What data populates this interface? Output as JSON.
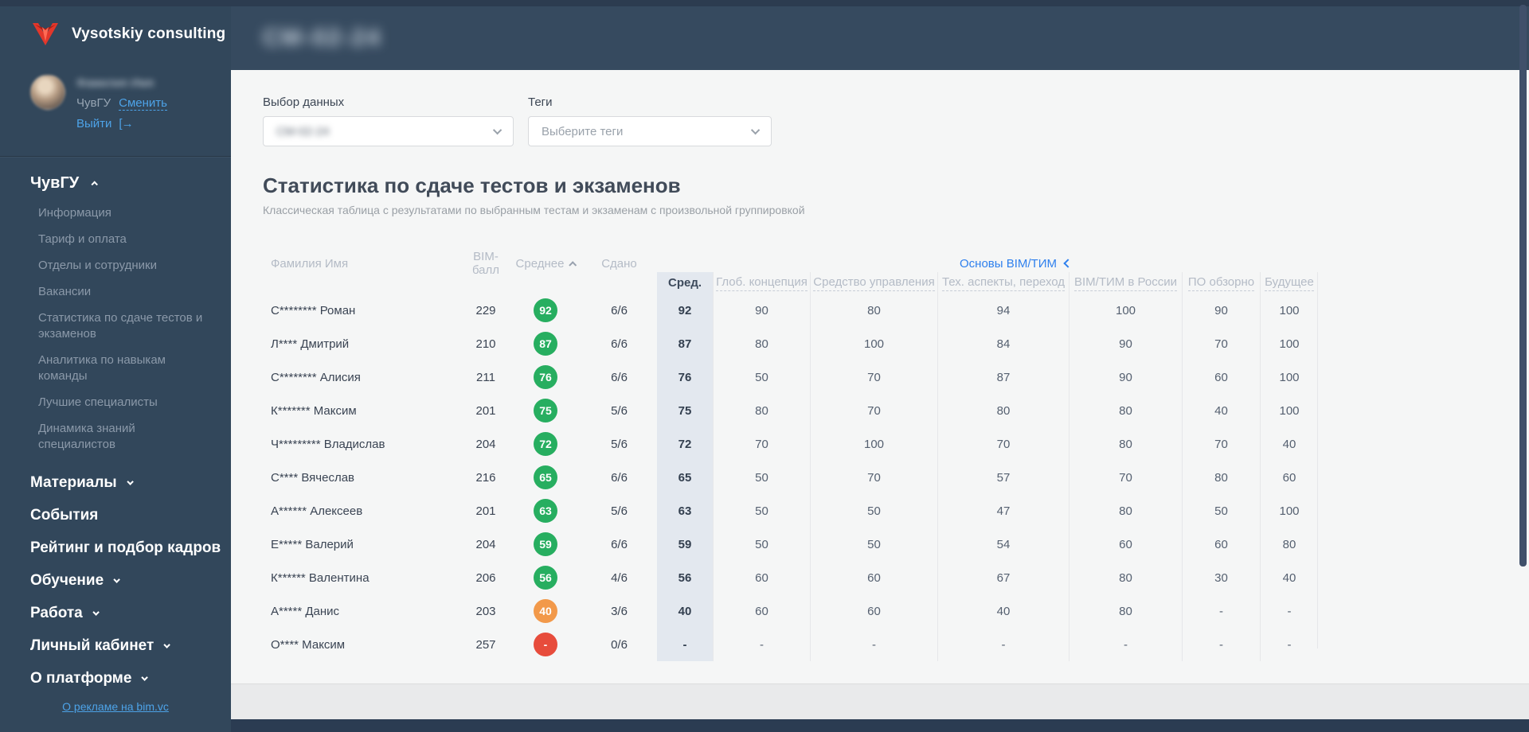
{
  "brand": {
    "name": "Vysotskiy consulting"
  },
  "topbar": {
    "title_redacted": "СМ-02-24"
  },
  "user": {
    "name_redacted": "Фамилия Имя",
    "org": "ЧувГУ",
    "change_link": "Сменить",
    "logout_link": "Выйти"
  },
  "sidebar": {
    "section_label": "ЧувГУ",
    "subitems": [
      {
        "label": "Информация"
      },
      {
        "label": "Тариф и оплата"
      },
      {
        "label": "Отделы и сотрудники"
      },
      {
        "label": "Вакансии"
      },
      {
        "label": "Статистика по сдаче тестов и экзаменов"
      },
      {
        "label": "Аналитика по навыкам команды"
      },
      {
        "label": "Лучшие специалисты"
      },
      {
        "label": "Динамика знаний специалистов"
      }
    ],
    "items": [
      {
        "label": "Материалы",
        "chevron": true
      },
      {
        "label": "События",
        "chevron": false
      },
      {
        "label": "Рейтинг и подбор кадров",
        "chevron": false
      },
      {
        "label": "Обучение",
        "chevron": true
      },
      {
        "label": "Работа",
        "chevron": true
      },
      {
        "label": "Личный кабинет",
        "chevron": true
      },
      {
        "label": "О платформе",
        "chevron": true
      }
    ],
    "footer_link": "О рекламе на bim.vc"
  },
  "filters": {
    "data_select_label": "Выбор данных",
    "data_select_value_redacted": "СМ-02-24",
    "tags_select_label": "Теги",
    "tags_select_placeholder": "Выберите теги"
  },
  "main": {
    "title": "Статистика по сдаче тестов и экзаменов",
    "subtitle": "Классическая таблица с результатами по выбранным тестам и экзаменам с произвольной группировкой",
    "group_link": "Основы BIM/ТИМ"
  },
  "table": {
    "col_name": "Фамилия Имя",
    "col_bim": "BIM-балл",
    "col_avg_badge": "Среднее",
    "col_passed": "Сдано",
    "col_avg": "Сред.",
    "subject_headers": [
      {
        "label": "Глоб. концепция"
      },
      {
        "label": "Средство управления"
      },
      {
        "label": "Тех. аспекты, переход"
      },
      {
        "label": "BIM/ТИМ в России"
      },
      {
        "label": "ПО обзорно"
      },
      {
        "label": "Будущее"
      }
    ],
    "rows": [
      {
        "name": "С******** Роман",
        "bim": "229",
        "badge": "92",
        "badge_color": "#27ae60",
        "passed": "6/6",
        "avg": "92",
        "s1": "90",
        "s2": "80",
        "s3": "94",
        "s4": "100",
        "s5": "90",
        "s6": "100"
      },
      {
        "name": "Л**** Дмитрий",
        "bim": "210",
        "badge": "87",
        "badge_color": "#27ae60",
        "passed": "6/6",
        "avg": "87",
        "s1": "80",
        "s2": "100",
        "s3": "84",
        "s4": "90",
        "s5": "70",
        "s6": "100"
      },
      {
        "name": "С******** Алисия",
        "bim": "211",
        "badge": "76",
        "badge_color": "#27ae60",
        "passed": "6/6",
        "avg": "76",
        "s1": "50",
        "s2": "70",
        "s3": "87",
        "s4": "90",
        "s5": "60",
        "s6": "100"
      },
      {
        "name": "К******* Максим",
        "bim": "201",
        "badge": "75",
        "badge_color": "#27ae60",
        "passed": "5/6",
        "avg": "75",
        "s1": "80",
        "s2": "70",
        "s3": "80",
        "s4": "80",
        "s5": "40",
        "s6": "100"
      },
      {
        "name": "Ч********* Владислав",
        "bim": "204",
        "badge": "72",
        "badge_color": "#27ae60",
        "passed": "5/6",
        "avg": "72",
        "s1": "70",
        "s2": "100",
        "s3": "70",
        "s4": "80",
        "s5": "70",
        "s6": "40"
      },
      {
        "name": "С**** Вячеслав",
        "bim": "216",
        "badge": "65",
        "badge_color": "#27ae60",
        "passed": "6/6",
        "avg": "65",
        "s1": "50",
        "s2": "70",
        "s3": "57",
        "s4": "70",
        "s5": "80",
        "s6": "60"
      },
      {
        "name": "А****** Алексеев",
        "bim": "201",
        "badge": "63",
        "badge_color": "#27ae60",
        "passed": "5/6",
        "avg": "63",
        "s1": "50",
        "s2": "50",
        "s3": "47",
        "s4": "80",
        "s5": "50",
        "s6": "100"
      },
      {
        "name": "Е***** Валерий",
        "bim": "204",
        "badge": "59",
        "badge_color": "#27ae60",
        "passed": "6/6",
        "avg": "59",
        "s1": "50",
        "s2": "50",
        "s3": "54",
        "s4": "60",
        "s5": "60",
        "s6": "80"
      },
      {
        "name": "К****** Валентина",
        "bim": "206",
        "badge": "56",
        "badge_color": "#27ae60",
        "passed": "4/6",
        "avg": "56",
        "s1": "60",
        "s2": "60",
        "s3": "67",
        "s4": "80",
        "s5": "30",
        "s6": "40"
      },
      {
        "name": "А***** Данис",
        "bim": "203",
        "badge": "40",
        "badge_color": "#f2994a",
        "passed": "3/6",
        "avg": "40",
        "s1": "60",
        "s2": "60",
        "s3": "40",
        "s4": "80",
        "s5": "-",
        "s6": "-"
      },
      {
        "name": "О**** Максим",
        "bim": "257",
        "badge": "-",
        "badge_color": "#e74c3c",
        "passed": "0/6",
        "avg": "-",
        "s1": "-",
        "s2": "-",
        "s3": "-",
        "s4": "-",
        "s5": "-",
        "s6": "-"
      }
    ]
  },
  "colors": {
    "accent_link": "#2f80ed",
    "green": "#27ae60",
    "orange": "#f2994a",
    "red": "#e74c3c"
  }
}
